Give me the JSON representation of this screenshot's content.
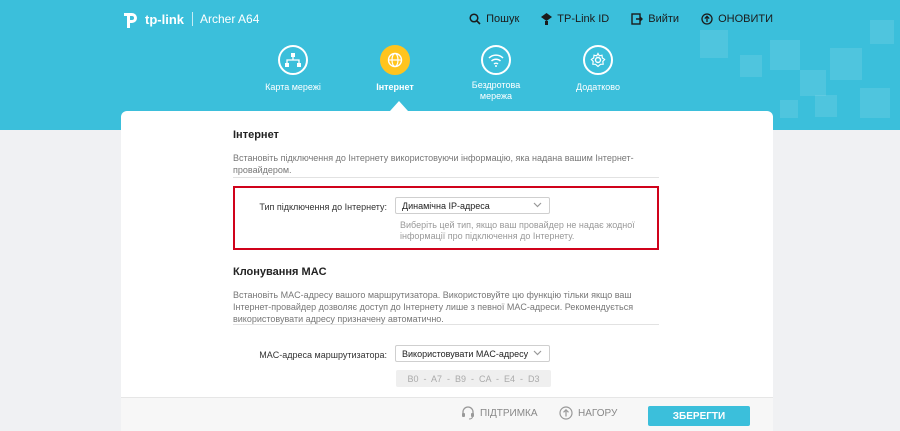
{
  "header": {
    "brand": "tp-link",
    "model": "Archer A64",
    "links": {
      "search": "Пошук",
      "tplink_id": "TP-Link ID",
      "logout": "Вийти",
      "update": "ОНОВИТИ"
    }
  },
  "nav": {
    "items": [
      {
        "label": "Карта мережі",
        "icon": "network-map-icon"
      },
      {
        "label": "Інтернет",
        "icon": "globe-icon",
        "active": true
      },
      {
        "label": "Бездротова мережа",
        "icon": "wifi-icon"
      },
      {
        "label": "Додатково",
        "icon": "gear-icon"
      }
    ]
  },
  "internet": {
    "title": "Інтернет",
    "description": "Встановіть підключення до Інтернету використовуючи інформацію, яка надана вашим Інтернет-провайдером.",
    "connection_label": "Тип підключення до Інтернету:",
    "connection_value": "Динамічна IP-адреса",
    "connection_hint": "Виберіть цей тип, якщо ваш провайдер не надає жодної інформації про підключення до Інтернету."
  },
  "mac_clone": {
    "title": "Клонування MAC",
    "description": "Встановіть MAC-адресу вашого маршрутизатора. Використовуйте цю функцію тільки якщо ваш Інтернет-провайдер дозволяє доступ до Інтернету лише з певної MAC-адреси. Рекомендується використовувати адресу призначену автоматично.",
    "router_mac_label": "MAC-адреса маршрутизатора:",
    "router_mac_value": "Використовувати MAC-адресу",
    "mac_address": "B0  -  A7  -  B9  -  CA  -  E4  -  D3"
  },
  "footer": {
    "support": "ПІДТРИМКА",
    "top": "НАГОРУ",
    "save": "ЗБЕРЕГТИ"
  },
  "colors": {
    "header_bg": "#3bbfdb",
    "active_nav": "#ffc41e",
    "highlight_border": "#d0021b",
    "save_button": "#3bbfdb"
  }
}
